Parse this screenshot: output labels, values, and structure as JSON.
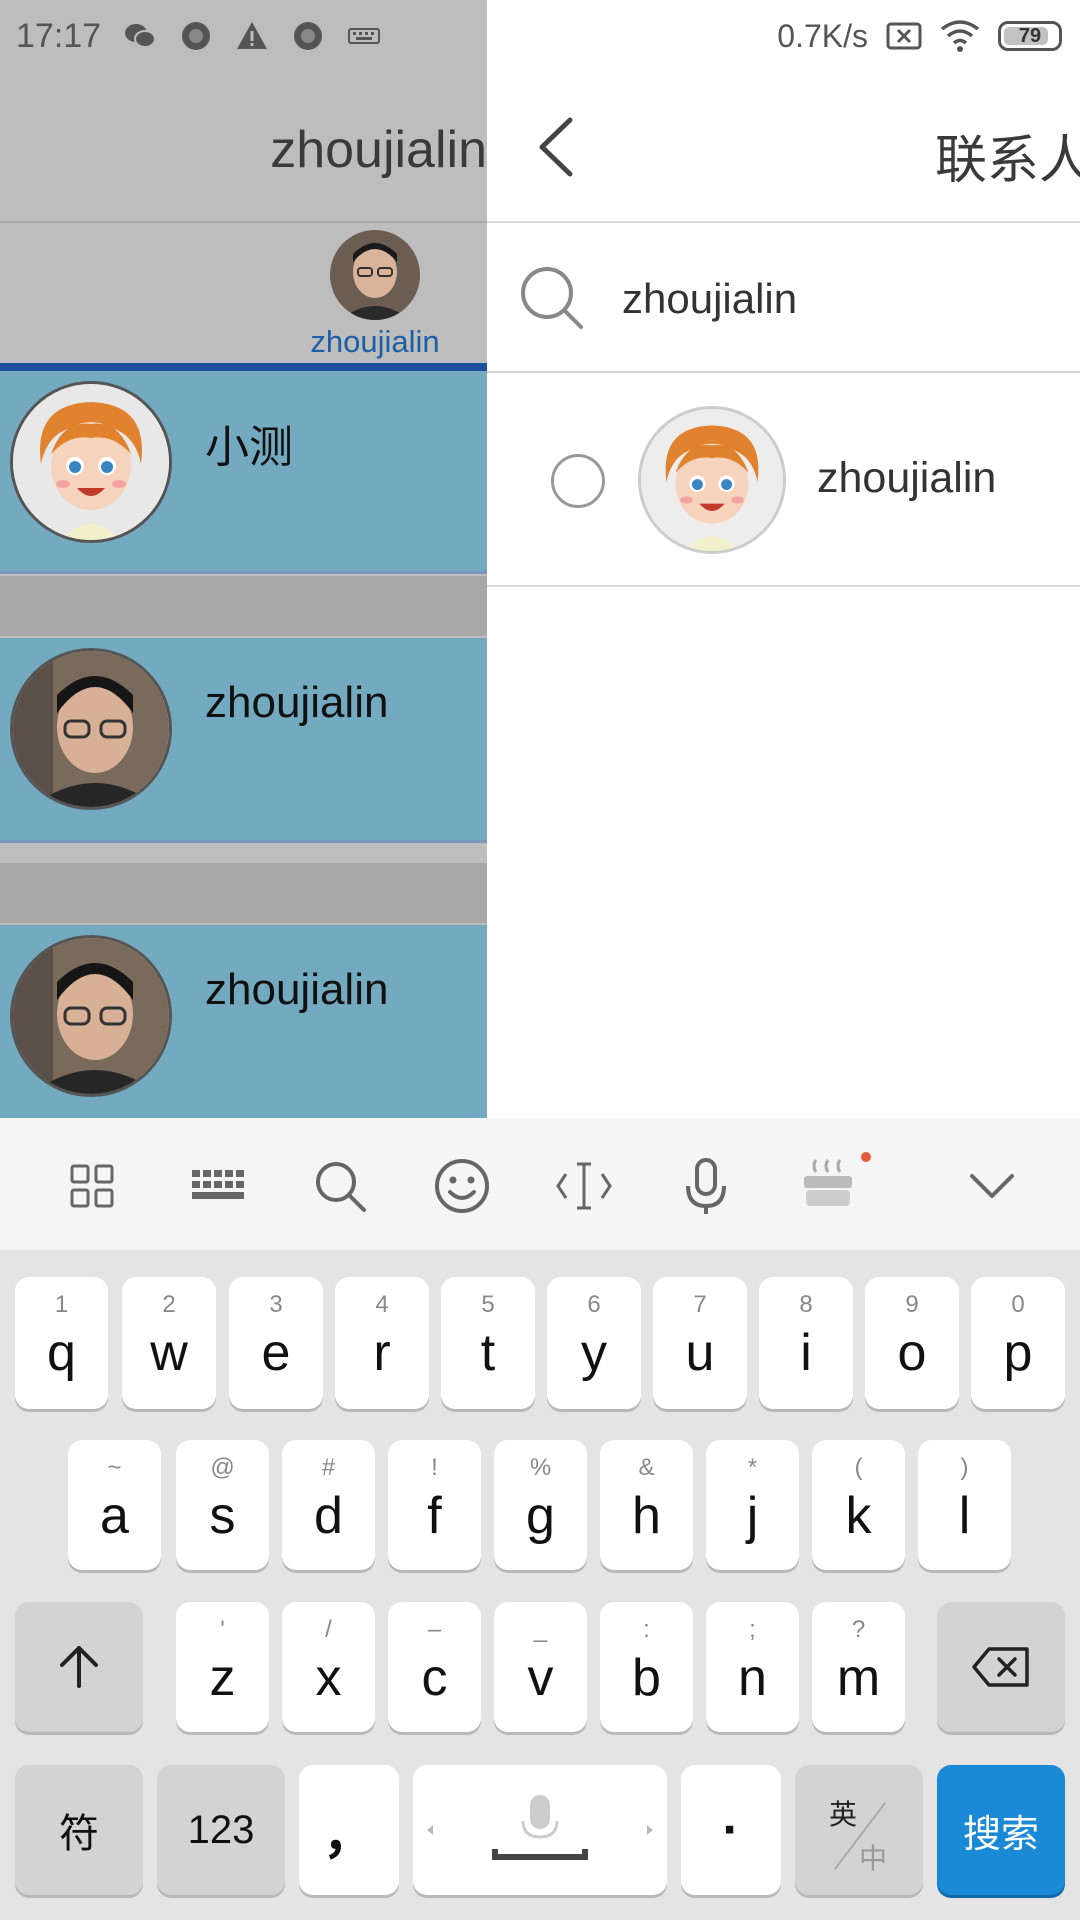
{
  "status_bar": {
    "time": "17:17",
    "net_speed": "0.7K/s",
    "battery": "79",
    "left_icons": [
      "wechat-icon",
      "circle-notification-icon",
      "warning-icon",
      "circle-notification-icon",
      "keyboard-icon"
    ],
    "right_icons": [
      "sim-x-icon",
      "wifi-icon",
      "battery-icon"
    ]
  },
  "background_screen": {
    "title": "zhoujialin",
    "current_user": {
      "name": "zhoujialin"
    },
    "contacts": [
      {
        "name": "小测",
        "avatar": "cartoon-girl-avatar"
      },
      {
        "name": "zhoujialin",
        "avatar": "photo-avatar"
      },
      {
        "name": "zhoujialin",
        "avatar": "photo-avatar"
      }
    ]
  },
  "panel": {
    "title": "联系人",
    "back_icon": "chevron-left-icon",
    "search": {
      "value": "zhoujialin",
      "icon": "search-icon"
    },
    "results": [
      {
        "name": "zhoujialin",
        "selected": false,
        "avatar": "cartoon-girl-avatar"
      }
    ]
  },
  "keyboard": {
    "toolbar": [
      "grid-icon",
      "keyboard-icon",
      "search-icon",
      "emoji-icon",
      "cursor-icon",
      "microphone-icon",
      "steam-icon",
      "collapse-chevron-icon"
    ],
    "row1": [
      {
        "main": "q",
        "sub": "1"
      },
      {
        "main": "w",
        "sub": "2"
      },
      {
        "main": "e",
        "sub": "3"
      },
      {
        "main": "r",
        "sub": "4"
      },
      {
        "main": "t",
        "sub": "5"
      },
      {
        "main": "y",
        "sub": "6"
      },
      {
        "main": "u",
        "sub": "7"
      },
      {
        "main": "i",
        "sub": "8"
      },
      {
        "main": "o",
        "sub": "9"
      },
      {
        "main": "p",
        "sub": "0"
      }
    ],
    "row2": [
      {
        "main": "a",
        "sub": "~"
      },
      {
        "main": "s",
        "sub": "@"
      },
      {
        "main": "d",
        "sub": "#"
      },
      {
        "main": "f",
        "sub": "!"
      },
      {
        "main": "g",
        "sub": "%"
      },
      {
        "main": "h",
        "sub": "&"
      },
      {
        "main": "j",
        "sub": "*"
      },
      {
        "main": "k",
        "sub": "("
      },
      {
        "main": "l",
        "sub": ")"
      }
    ],
    "row3": [
      {
        "main": "z",
        "sub": "'"
      },
      {
        "main": "x",
        "sub": "/"
      },
      {
        "main": "c",
        "sub": "–"
      },
      {
        "main": "v",
        "sub": "_"
      },
      {
        "main": "b",
        "sub": ":"
      },
      {
        "main": "n",
        "sub": ";"
      },
      {
        "main": "m",
        "sub": "?"
      }
    ],
    "symbols_label": "符",
    "numbers_label": "123",
    "comma_label": "，",
    "period_label": "·",
    "lang_top": "英",
    "lang_bottom": "中",
    "action_label": "搜索",
    "accent_color": "#1a8ad6"
  }
}
